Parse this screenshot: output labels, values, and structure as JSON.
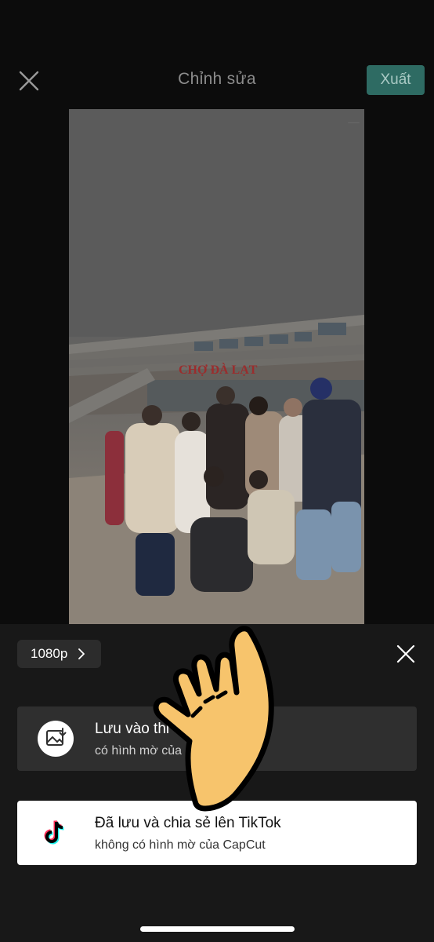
{
  "header": {
    "title": "Chỉnh sửa",
    "export_label": "Xuất",
    "close_icon": "close-icon"
  },
  "preview": {
    "sign_text": "CHỢ ĐÀ LẠT"
  },
  "sheet": {
    "resolution_label": "1080p",
    "options": [
      {
        "title": "Lưu vào thi",
        "subtitle": "có hình mờ của CapCut",
        "icon": "save-to-gallery-icon"
      },
      {
        "title": "Đã lưu và chia sẻ lên TikTok",
        "subtitle": "không có hình mờ của CapCut",
        "icon": "tiktok-icon"
      }
    ]
  },
  "colors": {
    "accent": "#2e6b63",
    "background": "#0c0c0c",
    "sheet": "#181818",
    "pointer_hand": "#f7c46c"
  }
}
